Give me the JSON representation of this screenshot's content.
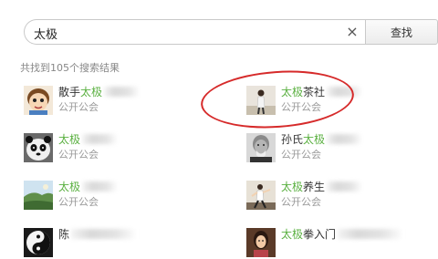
{
  "search": {
    "query": "太极",
    "button_label": "查找",
    "clear_icon": "×"
  },
  "result_count": "共找到105个搜索结果",
  "results": [
    {
      "prefix": "散手",
      "highlight": "太极",
      "suffix": "",
      "desc": "公开公会",
      "avatar": "cartoon-face"
    },
    {
      "prefix": "",
      "highlight": "太极",
      "suffix": "茶社",
      "desc": "公开公会",
      "avatar": "standing-person"
    },
    {
      "prefix": "",
      "highlight": "太极",
      "suffix": "",
      "desc": "公开公会",
      "avatar": "panda"
    },
    {
      "prefix": "孙氏",
      "highlight": "太极",
      "suffix": "",
      "desc": "公开公会",
      "avatar": "old-man"
    },
    {
      "prefix": "",
      "highlight": "太极",
      "suffix": "",
      "desc": "公开公会",
      "avatar": "landscape"
    },
    {
      "prefix": "",
      "highlight": "太极",
      "suffix": "养生",
      "desc": "公开公会",
      "avatar": "martial-artist"
    },
    {
      "prefix": "陈",
      "highlight": "",
      "suffix": "",
      "desc": "",
      "avatar": "yin-yang"
    },
    {
      "prefix": "",
      "highlight": "太极",
      "suffix": "拳入门",
      "desc": "",
      "avatar": "woman"
    }
  ],
  "colors": {
    "highlight": "#5ab040",
    "annotation": "#d62a2a"
  }
}
